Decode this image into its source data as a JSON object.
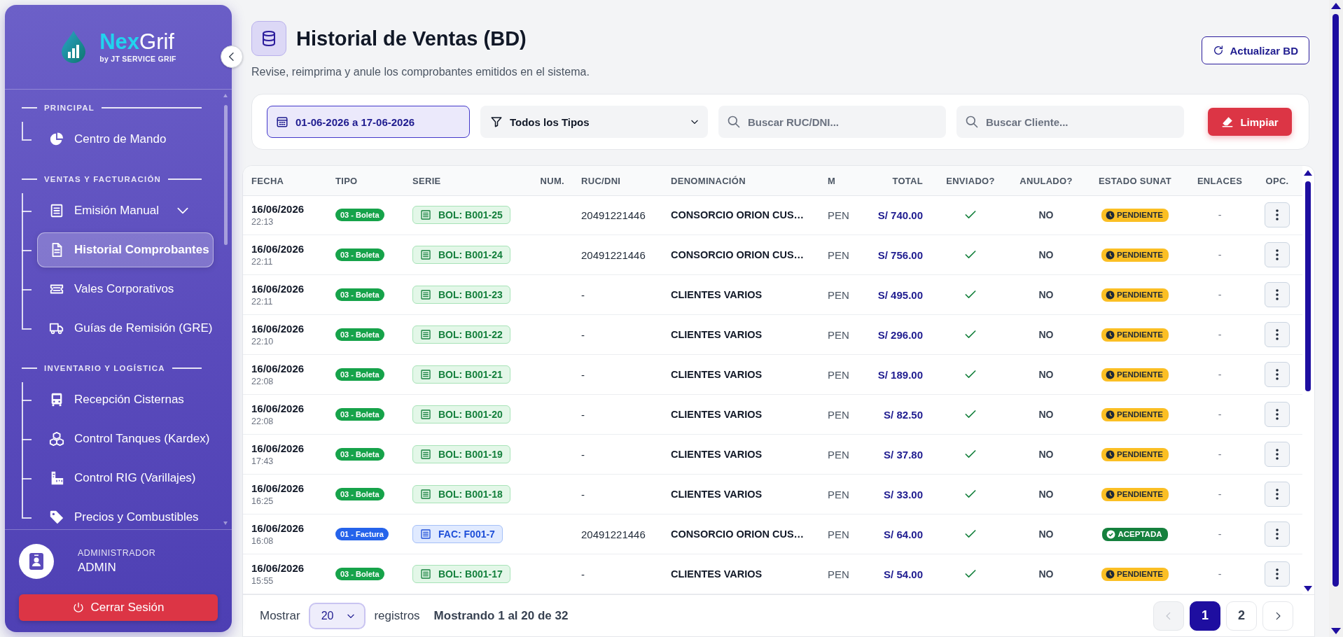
{
  "sidebar": {
    "brand": {
      "name_highlight": "Nex",
      "name_rest": "Grif",
      "tagline": "by JT SERVICE GRIF"
    },
    "sections": [
      {
        "title": "PRINCIPAL",
        "items": [
          {
            "label": "Centro de Mando",
            "kind": "link",
            "selected": false
          }
        ]
      },
      {
        "title": "VENTAS Y FACTURACIÓN",
        "items": [
          {
            "label": "Emisión Manual",
            "kind": "dropdown",
            "selected": false
          },
          {
            "label": "Historial Comprobantes",
            "kind": "link",
            "selected": true
          },
          {
            "label": "Vales Corporativos",
            "kind": "link",
            "selected": false
          },
          {
            "label": "Guías de Remisión (GRE)",
            "kind": "link",
            "selected": false
          }
        ]
      },
      {
        "title": "INVENTARIO Y LOGÍSTICA",
        "items": [
          {
            "label": "Recepción Cisternas",
            "kind": "link",
            "selected": false
          },
          {
            "label": "Control Tanques (Kardex)",
            "kind": "link",
            "selected": false
          },
          {
            "label": "Control RIG (Varillajes)",
            "kind": "link",
            "selected": false
          },
          {
            "label": "Precios y Combustibles",
            "kind": "link",
            "selected": false
          }
        ]
      }
    ],
    "user": {
      "role": "ADMINISTRADOR",
      "name": "ADMIN"
    },
    "logout_button": "Cerrar Sesión"
  },
  "header": {
    "title": "Historial de Ventas (BD)",
    "subtitle": "Revise, reimprima y anule los comprobantes emitidos en el sistema.",
    "refresh_button": "Actualizar BD"
  },
  "filters": {
    "date_range": "01-06-2026 a 17-06-2026",
    "type_select": "Todos los Tipos",
    "ruc_search": {
      "placeholder": "Buscar RUC/DNI..."
    },
    "client_search": {
      "placeholder": "Buscar Cliente..."
    },
    "clear_button": "Limpiar"
  },
  "table": {
    "columns": [
      "FECHA",
      "TIPO",
      "SERIE",
      "NUM.",
      "RUC/DNI",
      "DENOMINACIÓN",
      "M",
      "TOTAL",
      "ENVIADO?",
      "ANULADO?",
      "ESTADO SUNAT",
      "ENLACES",
      "OPC."
    ],
    "rows": [
      {
        "date": "16/06/2026",
        "time": "22:13",
        "kind": "boleta",
        "type": "03 - Boleta",
        "series": "BOL: B001-25",
        "ruc": "20491221446",
        "name": "CONSORCIO ORION CUS…",
        "currency": "PEN",
        "total": "S/ 740.00",
        "sent": true,
        "voided": "NO",
        "status": {
          "label": "PENDIENTE",
          "kind": "pending"
        },
        "links": "-"
      },
      {
        "date": "16/06/2026",
        "time": "22:11",
        "kind": "boleta",
        "type": "03 - Boleta",
        "series": "BOL: B001-24",
        "ruc": "20491221446",
        "name": "CONSORCIO ORION CUS…",
        "currency": "PEN",
        "total": "S/ 756.00",
        "sent": true,
        "voided": "NO",
        "status": {
          "label": "PENDIENTE",
          "kind": "pending"
        },
        "links": "-"
      },
      {
        "date": "16/06/2026",
        "time": "22:11",
        "kind": "boleta",
        "type": "03 - Boleta",
        "series": "BOL: B001-23",
        "ruc": "-",
        "name": "CLIENTES VARIOS",
        "currency": "PEN",
        "total": "S/ 495.00",
        "sent": true,
        "voided": "NO",
        "status": {
          "label": "PENDIENTE",
          "kind": "pending"
        },
        "links": "-"
      },
      {
        "date": "16/06/2026",
        "time": "22:10",
        "kind": "boleta",
        "type": "03 - Boleta",
        "series": "BOL: B001-22",
        "ruc": "-",
        "name": "CLIENTES VARIOS",
        "currency": "PEN",
        "total": "S/ 296.00",
        "sent": true,
        "voided": "NO",
        "status": {
          "label": "PENDIENTE",
          "kind": "pending"
        },
        "links": "-"
      },
      {
        "date": "16/06/2026",
        "time": "22:08",
        "kind": "boleta",
        "type": "03 - Boleta",
        "series": "BOL: B001-21",
        "ruc": "-",
        "name": "CLIENTES VARIOS",
        "currency": "PEN",
        "total": "S/ 189.00",
        "sent": true,
        "voided": "NO",
        "status": {
          "label": "PENDIENTE",
          "kind": "pending"
        },
        "links": "-"
      },
      {
        "date": "16/06/2026",
        "time": "22:08",
        "kind": "boleta",
        "type": "03 - Boleta",
        "series": "BOL: B001-20",
        "ruc": "-",
        "name": "CLIENTES VARIOS",
        "currency": "PEN",
        "total": "S/ 82.50",
        "sent": true,
        "voided": "NO",
        "status": {
          "label": "PENDIENTE",
          "kind": "pending"
        },
        "links": "-"
      },
      {
        "date": "16/06/2026",
        "time": "17:43",
        "kind": "boleta",
        "type": "03 - Boleta",
        "series": "BOL: B001-19",
        "ruc": "-",
        "name": "CLIENTES VARIOS",
        "currency": "PEN",
        "total": "S/ 37.80",
        "sent": true,
        "voided": "NO",
        "status": {
          "label": "PENDIENTE",
          "kind": "pending"
        },
        "links": "-"
      },
      {
        "date": "16/06/2026",
        "time": "16:25",
        "kind": "boleta",
        "type": "03 - Boleta",
        "series": "BOL: B001-18",
        "ruc": "-",
        "name": "CLIENTES VARIOS",
        "currency": "PEN",
        "total": "S/ 33.00",
        "sent": true,
        "voided": "NO",
        "status": {
          "label": "PENDIENTE",
          "kind": "pending"
        },
        "links": "-"
      },
      {
        "date": "16/06/2026",
        "time": "16:08",
        "kind": "factura",
        "type": "01 - Factura",
        "series": "FAC: F001-7",
        "ruc": "20491221446",
        "name": "CONSORCIO ORION CUS…",
        "currency": "PEN",
        "total": "S/ 64.00",
        "sent": true,
        "voided": "NO",
        "status": {
          "label": "ACEPTADA",
          "kind": "accepted"
        },
        "links": "-"
      },
      {
        "date": "16/06/2026",
        "time": "15:55",
        "kind": "boleta",
        "type": "03 - Boleta",
        "series": "BOL: B001-17",
        "ruc": "-",
        "name": "CLIENTES VARIOS",
        "currency": "PEN",
        "total": "S/ 54.00",
        "sent": true,
        "voided": "NO",
        "status": {
          "label": "PENDIENTE",
          "kind": "pending"
        },
        "links": "-"
      }
    ]
  },
  "footer": {
    "show_label": "Mostrar",
    "page_size": "20",
    "records_label": "registros",
    "summary": "Mostrando 1 al 20 de 32"
  },
  "pager": {
    "previous_disabled": true,
    "next_disabled": false,
    "pages": [
      {
        "label": "1",
        "selected": true
      },
      {
        "label": "2",
        "selected": false
      }
    ]
  }
}
